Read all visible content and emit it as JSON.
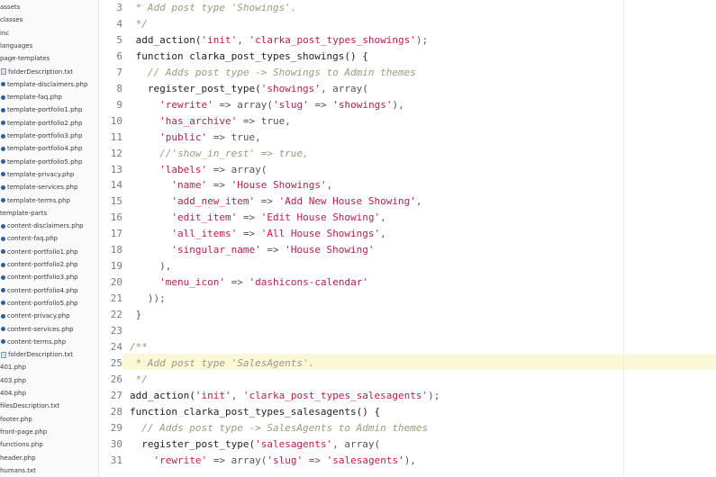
{
  "sidebar": {
    "items": [
      {
        "label": "assets",
        "type": "folder"
      },
      {
        "label": "classes",
        "type": "folder"
      },
      {
        "label": "inc",
        "type": "folder"
      },
      {
        "label": "languages",
        "type": "folder"
      },
      {
        "label": "page-templates",
        "type": "folder"
      },
      {
        "label": "folderDescription.txt",
        "type": "txt"
      },
      {
        "label": "template-disclaimers.php",
        "type": "php"
      },
      {
        "label": "template-faq.php",
        "type": "php"
      },
      {
        "label": "template-portfolio1.php",
        "type": "php"
      },
      {
        "label": "template-portfolio2.php",
        "type": "php"
      },
      {
        "label": "template-portfolio3.php",
        "type": "php"
      },
      {
        "label": "template-portfolio4.php",
        "type": "php"
      },
      {
        "label": "template-portfolio5.php",
        "type": "php"
      },
      {
        "label": "template-privacy.php",
        "type": "php"
      },
      {
        "label": "template-services.php",
        "type": "php"
      },
      {
        "label": "template-terms.php",
        "type": "php"
      },
      {
        "label": "template-parts",
        "type": "folder"
      },
      {
        "label": "content-disclaimers.php",
        "type": "php"
      },
      {
        "label": "content-faq.php",
        "type": "php"
      },
      {
        "label": "content-portfolio1.php",
        "type": "php"
      },
      {
        "label": "content-portfolio2.php",
        "type": "php"
      },
      {
        "label": "content-portfolio3.php",
        "type": "php"
      },
      {
        "label": "content-portfolio4.php",
        "type": "php"
      },
      {
        "label": "content-portfolio5.php",
        "type": "php"
      },
      {
        "label": "content-privacy.php",
        "type": "php"
      },
      {
        "label": "content-services.php",
        "type": "php"
      },
      {
        "label": "content-terms.php",
        "type": "php"
      },
      {
        "label": "folderDescription.txt",
        "type": "txt"
      },
      {
        "label": "401.php",
        "type": "file"
      },
      {
        "label": "403.php",
        "type": "file"
      },
      {
        "label": "404.php",
        "type": "file"
      },
      {
        "label": "filesDescription.txt",
        "type": "file"
      },
      {
        "label": "footer.php",
        "type": "file"
      },
      {
        "label": "front-page.php",
        "type": "file"
      },
      {
        "label": "functions.php",
        "type": "file"
      },
      {
        "label": "header.php",
        "type": "file"
      },
      {
        "label": "humans.txt",
        "type": "file"
      }
    ]
  },
  "editor": {
    "active_line": "25",
    "lines": [
      {
        "n": "3",
        "tokens": [
          {
            "t": " * Add post type 'Showings'.",
            "c": "cm"
          }
        ]
      },
      {
        "n": "4",
        "tokens": [
          {
            "t": " */",
            "c": "cm"
          }
        ]
      },
      {
        "n": "5",
        "tokens": [
          {
            "t": " add_action(",
            "c": "fn"
          },
          {
            "t": "'init'",
            "c": "st"
          },
          {
            "t": ", ",
            "c": "op"
          },
          {
            "t": "'clarka_post_types_showings'",
            "c": "st"
          },
          {
            "t": ");",
            "c": "op"
          }
        ]
      },
      {
        "n": "6",
        "tokens": [
          {
            "t": " function clarka_post_types_showings() {",
            "c": "kw"
          }
        ]
      },
      {
        "n": "7",
        "tokens": [
          {
            "t": "   // Adds post type -> Showings to Admin themes",
            "c": "cm"
          }
        ]
      },
      {
        "n": "8",
        "tokens": [
          {
            "t": "   register_post_type(",
            "c": "fn"
          },
          {
            "t": "'showings'",
            "c": "st"
          },
          {
            "t": ", array(",
            "c": "op"
          }
        ]
      },
      {
        "n": "9",
        "tokens": [
          {
            "t": "     ",
            "c": "op"
          },
          {
            "t": "'rewrite'",
            "c": "st"
          },
          {
            "t": " => array(",
            "c": "op"
          },
          {
            "t": "'slug'",
            "c": "st"
          },
          {
            "t": " => ",
            "c": "op"
          },
          {
            "t": "'showings'",
            "c": "st"
          },
          {
            "t": "),",
            "c": "op"
          }
        ]
      },
      {
        "n": "10",
        "tokens": [
          {
            "t": "     ",
            "c": "op"
          },
          {
            "t": "'has_archive'",
            "c": "st"
          },
          {
            "t": " => true,",
            "c": "op"
          }
        ]
      },
      {
        "n": "11",
        "tokens": [
          {
            "t": "     ",
            "c": "op"
          },
          {
            "t": "'public'",
            "c": "st"
          },
          {
            "t": " => true,",
            "c": "op"
          }
        ]
      },
      {
        "n": "12",
        "tokens": [
          {
            "t": "     //'show_in_rest' => true,",
            "c": "cm"
          }
        ]
      },
      {
        "n": "13",
        "tokens": [
          {
            "t": "     ",
            "c": "op"
          },
          {
            "t": "'labels'",
            "c": "st"
          },
          {
            "t": " => array(",
            "c": "op"
          }
        ]
      },
      {
        "n": "14",
        "tokens": [
          {
            "t": "       ",
            "c": "op"
          },
          {
            "t": "'name'",
            "c": "st"
          },
          {
            "t": " => ",
            "c": "op"
          },
          {
            "t": "'House Showings'",
            "c": "st"
          },
          {
            "t": ",",
            "c": "op"
          }
        ]
      },
      {
        "n": "15",
        "tokens": [
          {
            "t": "       ",
            "c": "op"
          },
          {
            "t": "'add_new_item'",
            "c": "st"
          },
          {
            "t": " => ",
            "c": "op"
          },
          {
            "t": "'Add New House Showing'",
            "c": "st"
          },
          {
            "t": ",",
            "c": "op"
          }
        ]
      },
      {
        "n": "16",
        "tokens": [
          {
            "t": "       ",
            "c": "op"
          },
          {
            "t": "'edit_item'",
            "c": "st"
          },
          {
            "t": " => ",
            "c": "op"
          },
          {
            "t": "'Edit House Showing'",
            "c": "st"
          },
          {
            "t": ",",
            "c": "op"
          }
        ]
      },
      {
        "n": "17",
        "tokens": [
          {
            "t": "       ",
            "c": "op"
          },
          {
            "t": "'all_items'",
            "c": "st"
          },
          {
            "t": " => ",
            "c": "op"
          },
          {
            "t": "'All House Showings'",
            "c": "st"
          },
          {
            "t": ",",
            "c": "op"
          }
        ]
      },
      {
        "n": "18",
        "tokens": [
          {
            "t": "       ",
            "c": "op"
          },
          {
            "t": "'singular_name'",
            "c": "st"
          },
          {
            "t": " => ",
            "c": "op"
          },
          {
            "t": "'House Showing'",
            "c": "st"
          }
        ]
      },
      {
        "n": "19",
        "tokens": [
          {
            "t": "     ),",
            "c": "op"
          }
        ]
      },
      {
        "n": "20",
        "tokens": [
          {
            "t": "     ",
            "c": "op"
          },
          {
            "t": "'menu_icon'",
            "c": "st"
          },
          {
            "t": " => ",
            "c": "op"
          },
          {
            "t": "'dashicons-calendar'",
            "c": "st"
          }
        ]
      },
      {
        "n": "21",
        "tokens": [
          {
            "t": "   ));",
            "c": "op"
          }
        ]
      },
      {
        "n": "22",
        "tokens": [
          {
            "t": " }",
            "c": "op"
          }
        ]
      },
      {
        "n": "23",
        "tokens": [
          {
            "t": "",
            "c": "op"
          }
        ]
      },
      {
        "n": "24",
        "tokens": [
          {
            "t": "/**",
            "c": "cm"
          }
        ]
      },
      {
        "n": "25",
        "tokens": [
          {
            "t": " * Add post type 'SalesAgents'.",
            "c": "cm"
          }
        ]
      },
      {
        "n": "26",
        "tokens": [
          {
            "t": " */",
            "c": "cm"
          }
        ]
      },
      {
        "n": "27",
        "tokens": [
          {
            "t": "add_action(",
            "c": "fn"
          },
          {
            "t": "'init'",
            "c": "st"
          },
          {
            "t": ", ",
            "c": "op"
          },
          {
            "t": "'clarka_post_types_salesagents'",
            "c": "st"
          },
          {
            "t": ");",
            "c": "op"
          }
        ]
      },
      {
        "n": "28",
        "tokens": [
          {
            "t": "function clarka_post_types_salesagents() {",
            "c": "kw"
          }
        ]
      },
      {
        "n": "29",
        "tokens": [
          {
            "t": "  // Adds post type -> SalesAgents to Admin themes",
            "c": "cm"
          }
        ]
      },
      {
        "n": "30",
        "tokens": [
          {
            "t": "  register_post_type(",
            "c": "fn"
          },
          {
            "t": "'salesagents'",
            "c": "st"
          },
          {
            "t": ", array(",
            "c": "op"
          }
        ]
      },
      {
        "n": "31",
        "tokens": [
          {
            "t": "    ",
            "c": "op"
          },
          {
            "t": "'rewrite'",
            "c": "st"
          },
          {
            "t": " => array(",
            "c": "op"
          },
          {
            "t": "'slug'",
            "c": "st"
          },
          {
            "t": " => ",
            "c": "op"
          },
          {
            "t": "'salesagents'",
            "c": "st"
          },
          {
            "t": "),",
            "c": "op"
          }
        ]
      }
    ]
  }
}
